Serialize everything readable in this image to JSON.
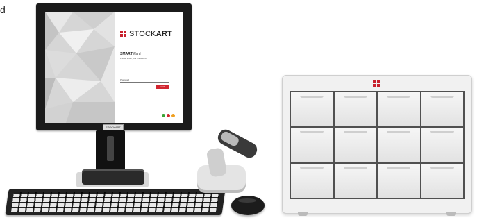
{
  "page_letter": "d",
  "screen": {
    "brand_prefix": "STOCK",
    "brand_suffix": "ART",
    "app_title_bold": "SMART",
    "app_title_rest": "Ward",
    "app_subtitle": "Please enter your Password",
    "password_label": "Password",
    "login_button": "LOGIN",
    "status_colors": [
      "#3aa335",
      "#d22630",
      "#f0a020"
    ]
  },
  "monitor_label": "STOCKART",
  "brand_color": "#c8202c"
}
